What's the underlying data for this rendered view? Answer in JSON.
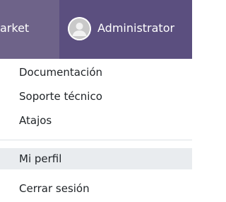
{
  "topbar": {
    "market_tab_label": "arket",
    "user_menu": {
      "avatar_icon": "user-avatar-icon",
      "label": "Administrator"
    }
  },
  "dropdown": {
    "items": [
      {
        "label": "Documentación"
      },
      {
        "label": "Soporte técnico"
      },
      {
        "label": "Atajos"
      },
      {
        "label": "Mi perfil",
        "highlighted": true
      },
      {
        "label": "Cerrar sesión"
      }
    ]
  },
  "colors": {
    "navbar": "#5b4f7f",
    "active_tab": "#6e6389",
    "hover_item": "#e9ecef"
  }
}
